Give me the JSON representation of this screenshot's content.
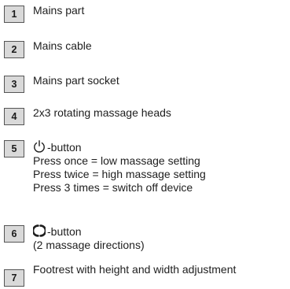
{
  "items": [
    {
      "number": "1",
      "lines": [
        "Mains part"
      ]
    },
    {
      "number": "2",
      "lines": [
        "Mains cable"
      ]
    },
    {
      "number": "3",
      "lines": [
        "Mains part socket"
      ]
    },
    {
      "number": "4",
      "lines": [
        "2x3 rotating massage heads"
      ]
    },
    {
      "number": "5",
      "icon": "power-icon",
      "title": "-button",
      "lines": [
        "Press once = low massage setting",
        "Press twice = high massage setting",
        "Press 3 times = switch off device"
      ]
    },
    {
      "number": "6",
      "icon": "rotation-direction-icon",
      "title": "-button",
      "lines": [
        "(2 massage directions)"
      ]
    },
    {
      "number": "7",
      "lines": [
        "Footrest with height and width adjustment"
      ]
    }
  ]
}
